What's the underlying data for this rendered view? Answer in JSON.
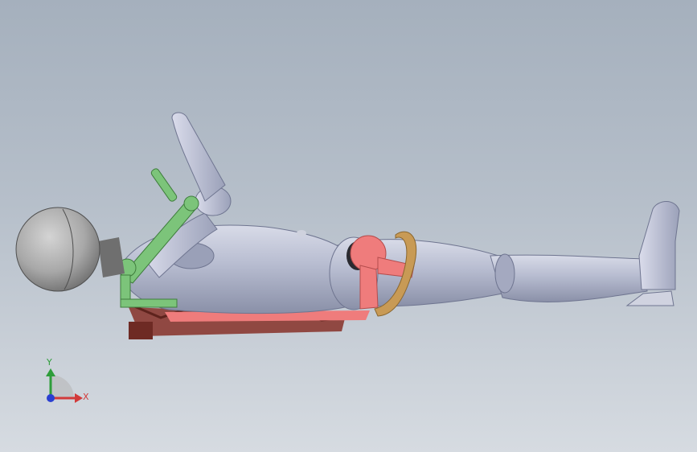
{
  "viewport": {
    "background_top": "#a5b0bd",
    "background_bottom": "#d6dbe1"
  },
  "model": {
    "colors": {
      "body": "#b7bcd0",
      "body_shadow": "#8f94aa",
      "head": "#a8a8a8",
      "arm_linkage": "#7cc47a",
      "hip_link": "#ef7c7c",
      "knee_ring": "#c89a55",
      "brace": "#8a3a32"
    }
  },
  "triad": {
    "y_label": "Y",
    "x_label": "X",
    "colors": {
      "x": "#d23a3a",
      "y": "#2e9d3a",
      "z": "#2a3fd1"
    }
  }
}
